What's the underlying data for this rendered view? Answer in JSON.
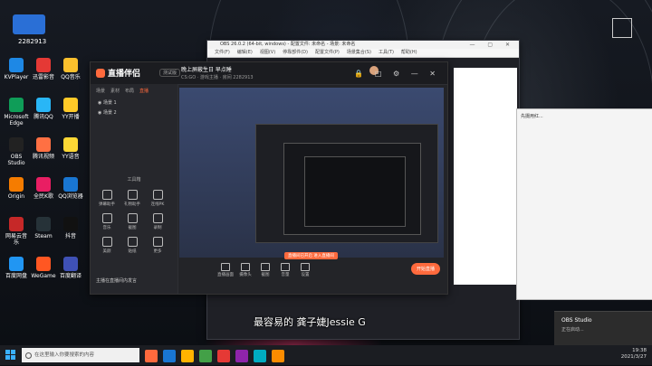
{
  "desktop": {
    "top_badge": "2282913",
    "icons": [
      {
        "label": "KVPlayer",
        "color": "#1e88e5"
      },
      {
        "label": "迅雷影音",
        "color": "#e53935"
      },
      {
        "label": "QQ音乐",
        "color": "#fbc02d"
      },
      {
        "label": "Microsoft Edge",
        "color": "#0f9d58"
      },
      {
        "label": "腾讯QQ",
        "color": "#29b6f6"
      },
      {
        "label": "YY开播",
        "color": "#ffca28"
      },
      {
        "label": "OBS Studio",
        "color": "#222222"
      },
      {
        "label": "腾讯视频",
        "color": "#ff7043"
      },
      {
        "label": "YY语音",
        "color": "#fdd835"
      },
      {
        "label": "Origin",
        "color": "#f57c00"
      },
      {
        "label": "全民K歌",
        "color": "#e91e63"
      },
      {
        "label": "QQ浏览器",
        "color": "#1976d2"
      },
      {
        "label": "网易云音乐",
        "color": "#c62828"
      },
      {
        "label": "Steam",
        "color": "#263238"
      },
      {
        "label": "抖音",
        "color": "#111111"
      },
      {
        "label": "百度网盘",
        "color": "#2196f3"
      },
      {
        "label": "WeGame",
        "color": "#ff5722"
      },
      {
        "label": "百度翻译",
        "color": "#3f51b5"
      }
    ]
  },
  "obs": {
    "title": "OBS 26.0.2 (64-bit, windows) - 配置文件: 未命名 - 场景: 未命名",
    "menu": [
      "文件(F)",
      "编辑(E)",
      "视图(V)",
      "停靠部件(D)",
      "配置文件(P)",
      "场景集合(S)",
      "工具(T)",
      "帮助(H)"
    ]
  },
  "zbpl": {
    "logo": "直播伴侣",
    "version": "测试版",
    "room_title": "晚上屏蔽生日 早点睡",
    "room_sub": "CS:GO · 游戏主播 · 房间 2282913",
    "tabs": [
      "场景",
      "素材",
      "布局",
      "直播"
    ],
    "active_tab": "直播",
    "scenes": [
      "场景 1",
      "场景 2"
    ],
    "tools_title": "工具箱",
    "tools": [
      "弹幕助手",
      "礼物助手",
      "连线PK",
      "音乐",
      "截图",
      "录制",
      "美颜",
      "贴纸",
      "更多"
    ],
    "bottom_buttons": [
      "直播画面",
      "摄像头",
      "截图",
      "音量",
      "设置"
    ],
    "live_button": "开始直播",
    "notice": "直播间已开启 进入直播间",
    "tip": "主播在直播间内发言"
  },
  "right_window": {
    "text": "先摄用红..."
  },
  "subtitle": "最容易的    龚子婕Jessie G",
  "notify": {
    "title": "OBS Studio",
    "body": "正在启动..."
  },
  "taskbar": {
    "search_placeholder": "在这里输入你要搜索的内容",
    "time": "19:38",
    "date": "2021/3/27",
    "apps": [
      "#ff6a3d",
      "#1976d2",
      "#ffb300",
      "#43a047",
      "#e53935",
      "#8e24aa",
      "#00acc1",
      "#fb8c00"
    ]
  }
}
